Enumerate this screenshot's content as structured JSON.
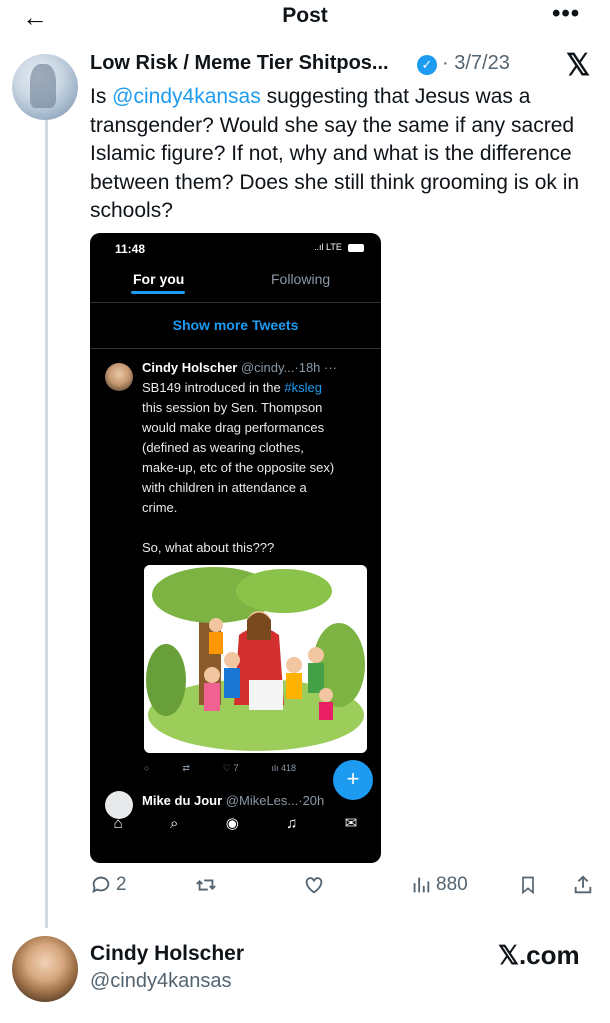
{
  "header": {
    "back_icon": "arrow-left-icon",
    "title": "Post",
    "more_label": "•••"
  },
  "tweet": {
    "author_name": "Low Risk / Meme Tier Shitpos...",
    "verified_icon": "verified-badge-icon",
    "date": "· 3/7/23",
    "logo": "𝕏",
    "text_before": "Is ",
    "mention": "@cindy4kansas",
    "text_after": " suggesting that Jesus was a transgender?  Would she say the same if any sacred Islamic figure? If not, why and what is the difference between them?  Does she still think grooming is ok in schools?",
    "actions": {
      "replies": "2",
      "views": "880"
    }
  },
  "screenshot": {
    "time": "11:48",
    "status": "..ıl LTE",
    "tab_for_you": "For you",
    "tab_following": "Following",
    "show_more": "Show more Tweets",
    "inner_name": "Cindy Holscher",
    "inner_handle": " @cindy...·18h  ···",
    "inner_text_1": "SB149 introduced in the ",
    "inner_tag": "#ksleg",
    "inner_text_2": "\nthis session by Sen. Thompson\nwould make drag performances\n(defined as wearing clothes,\nmake-up, etc of the opposite sex)\nwith children in attendance a\ncrime.\n\nSo, what about this???",
    "inner_likes": "7",
    "inner_views": "418",
    "fab": "+",
    "next_name": "Mike du Jour",
    "next_handle": " @MikeLes...·20h"
  },
  "card": {
    "name": "Cindy Holscher",
    "handle": "@cindy4kansas",
    "source": "𝕏.com"
  }
}
